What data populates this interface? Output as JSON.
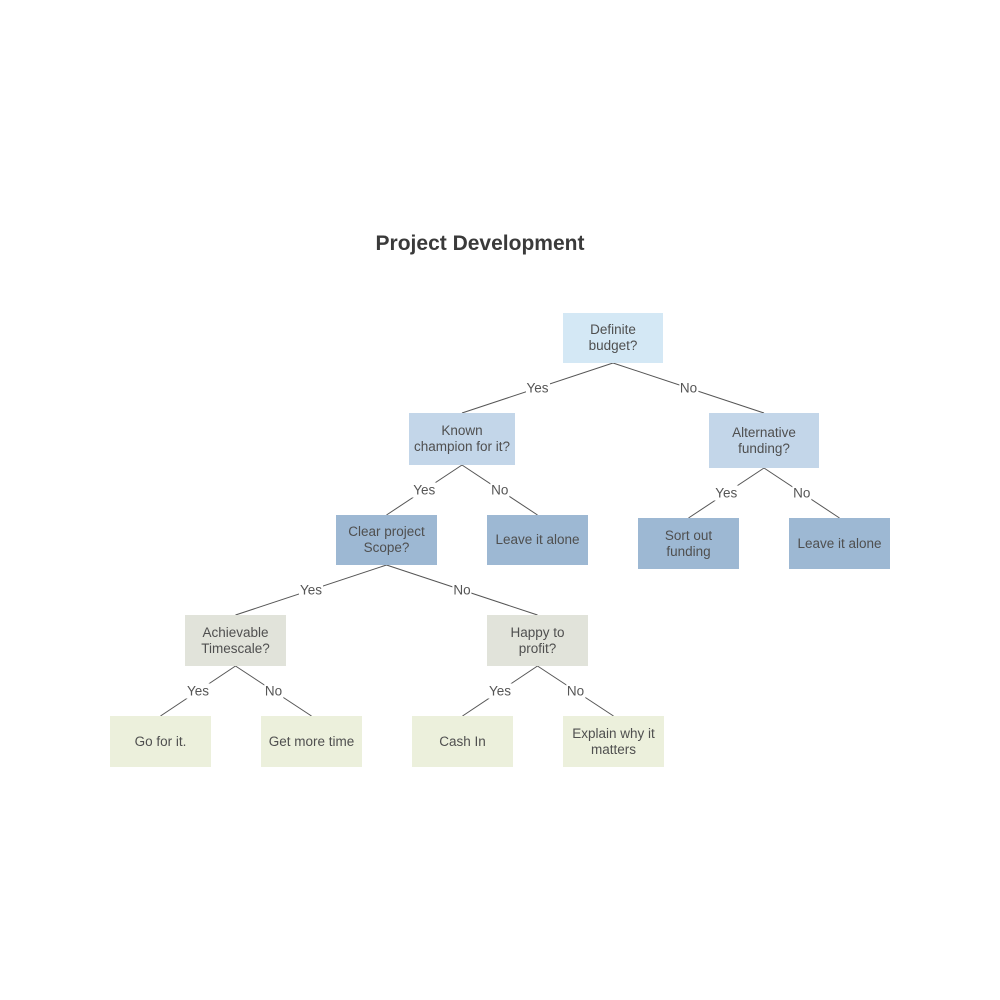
{
  "title": "Project Development",
  "nodes": [
    {
      "id": "root",
      "text": "Definite budget?",
      "lines": [
        "Definite",
        "budget?"
      ],
      "level": 0
    },
    {
      "id": "champion",
      "text": "Known champion for it?",
      "lines": [
        "Known",
        "champion for it?"
      ],
      "level": 1
    },
    {
      "id": "altfunding",
      "text": "Alternative funding?",
      "lines": [
        "Alternative",
        "funding?"
      ],
      "level": 1
    },
    {
      "id": "scope",
      "text": "Clear project Scope?",
      "lines": [
        "Clear project",
        "Scope?"
      ],
      "level": 2
    },
    {
      "id": "leave1",
      "text": "Leave it alone",
      "lines": [
        "Leave it alone"
      ],
      "level": 2
    },
    {
      "id": "sortfunding",
      "text": "Sort out funding",
      "lines": [
        "Sort out",
        "funding"
      ],
      "level": 2
    },
    {
      "id": "leave2",
      "text": "Leave it alone",
      "lines": [
        "Leave it alone"
      ],
      "level": 2
    },
    {
      "id": "timescale",
      "text": "Achievable Timescale?",
      "lines": [
        "Achievable",
        "Timescale?"
      ],
      "level": 3
    },
    {
      "id": "profit",
      "text": "Happy to profit?",
      "lines": [
        "Happy to",
        "profit?"
      ],
      "level": 3
    },
    {
      "id": "goforit",
      "text": "Go for it.",
      "lines": [
        "Go for it."
      ],
      "level": 4
    },
    {
      "id": "moretime",
      "text": "Get more time",
      "lines": [
        "Get more time"
      ],
      "level": 4
    },
    {
      "id": "cashin",
      "text": "Cash In",
      "lines": [
        "Cash In"
      ],
      "level": 4
    },
    {
      "id": "explain",
      "text": "Explain why it matters",
      "lines": [
        "Explain why it",
        "matters"
      ],
      "level": 4
    }
  ],
  "edges": [
    {
      "from": "root",
      "to": "champion",
      "label": "Yes"
    },
    {
      "from": "root",
      "to": "altfunding",
      "label": "No"
    },
    {
      "from": "champion",
      "to": "scope",
      "label": "Yes"
    },
    {
      "from": "champion",
      "to": "leave1",
      "label": "No"
    },
    {
      "from": "altfunding",
      "to": "sortfunding",
      "label": "Yes"
    },
    {
      "from": "altfunding",
      "to": "leave2",
      "label": "No"
    },
    {
      "from": "scope",
      "to": "timescale",
      "label": "Yes"
    },
    {
      "from": "scope",
      "to": "profit",
      "label": "No"
    },
    {
      "from": "timescale",
      "to": "goforit",
      "label": "Yes"
    },
    {
      "from": "timescale",
      "to": "moretime",
      "label": "No"
    },
    {
      "from": "profit",
      "to": "cashin",
      "label": "Yes"
    },
    {
      "from": "profit",
      "to": "explain",
      "label": "No"
    }
  ],
  "colors": {
    "level0": "#d4e8f5",
    "level1": "#c3d6e9",
    "level2": "#9db8d3",
    "level3": "#e1e3da",
    "level4": "#ecf0dc",
    "edge": "#555555"
  }
}
